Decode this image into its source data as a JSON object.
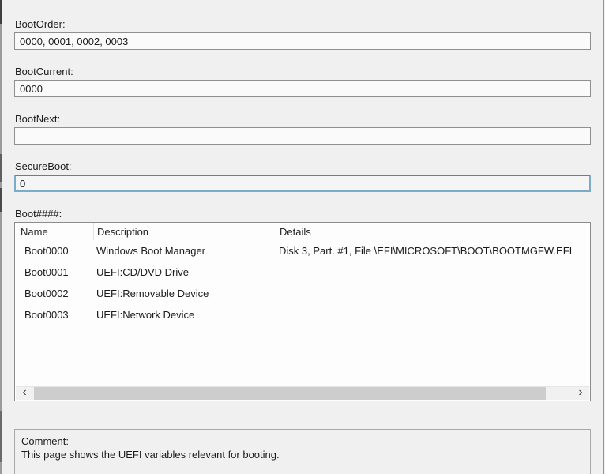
{
  "window": {
    "background": "#f0f0f0",
    "field_background": "#fafafa",
    "field_border": "#8f8f8f",
    "focus_border_color": "#6ba3c3",
    "list_border": "#8c8c8c",
    "scrollbar_thumb_color": "#cdcdcd"
  },
  "fields": [
    {
      "label": "BootOrder:",
      "value": "0000, 0001, 0002, 0003"
    },
    {
      "label": "BootCurrent:",
      "value": "0000"
    },
    {
      "label": "BootNext:",
      "value": ""
    },
    {
      "label": "SecureBoot:",
      "value": "0"
    }
  ],
  "boot_list": {
    "label": "Boot####:",
    "columns": {
      "name": "Name",
      "description": "Description",
      "details": "Details"
    },
    "rows": [
      {
        "name": "Boot0000",
        "description": "Windows Boot Manager",
        "details": "Disk 3, Part. #1, File \\EFI\\MICROSOFT\\BOOT\\BOOTMGFW.EFI"
      },
      {
        "name": "Boot0001",
        "description": "UEFI:CD/DVD Drive",
        "details": ""
      },
      {
        "name": "Boot0002",
        "description": "UEFI:Removable Device",
        "details": ""
      },
      {
        "name": "Boot0003",
        "description": "UEFI:Network Device",
        "details": ""
      }
    ],
    "scrollbar": {
      "left_icon": "‹",
      "right_icon": "›"
    }
  },
  "comment": {
    "label": "Comment:",
    "text": "This page shows the UEFI variables relevant for booting."
  }
}
